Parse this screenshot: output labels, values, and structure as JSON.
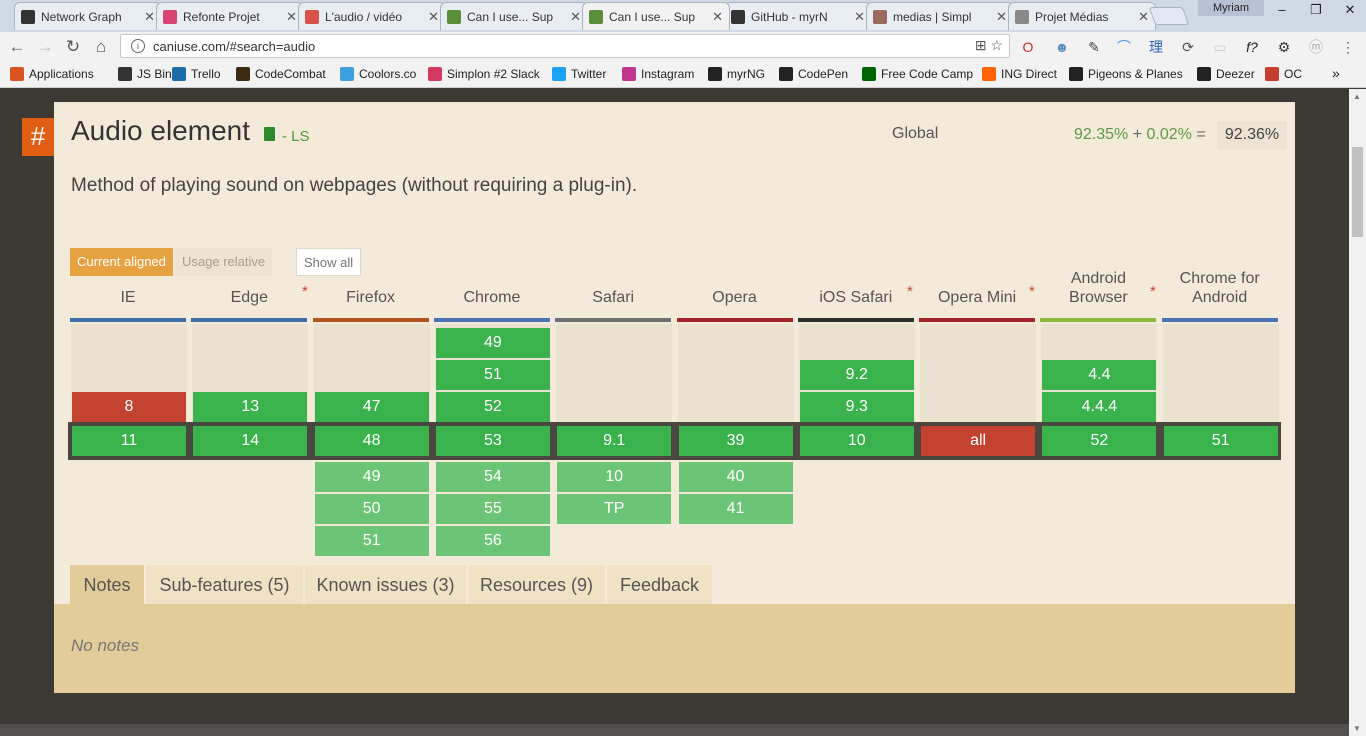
{
  "browser": {
    "tabs": [
      {
        "title": "Network Graph",
        "icon": "github-icon",
        "color": "#333333"
      },
      {
        "title": "Refonte Projet",
        "icon": "trello-icon",
        "color": "#d84572"
      },
      {
        "title": "L'audio / vidéo",
        "icon": "asterisk-icon",
        "color": "#d8524a"
      },
      {
        "title": "Can I use... Sup",
        "icon": "caniuse-icon",
        "color": "#5b8f3a"
      },
      {
        "title": "Can I use... Sup",
        "icon": "caniuse-icon",
        "color": "#5b8f3a"
      },
      {
        "title": "GitHub - myrN",
        "icon": "github-icon",
        "color": "#333333"
      },
      {
        "title": "medias | Simpl",
        "icon": "hash-icon",
        "color": "#9b6a5f"
      },
      {
        "title": "Projet Médias",
        "icon": "document-icon",
        "color": "#888888"
      }
    ],
    "profile_name": "Myriam",
    "url": "caniuse.com/#search=audio",
    "bookmarks": [
      {
        "label": "Applications",
        "icon": "apps-icon",
        "color": "#d9541e"
      },
      {
        "label": "JS Bin",
        "icon": "jsbin-icon",
        "color": "#333333"
      },
      {
        "label": "Trello",
        "icon": "trello-icon",
        "color": "#1c6ca8"
      },
      {
        "label": "CodeCombat",
        "icon": "codecombat-icon",
        "color": "#3b2b12"
      },
      {
        "label": "Coolors.co",
        "icon": "coolors-icon",
        "color": "#3da0dc"
      },
      {
        "label": "Simplon #2 Slack",
        "icon": "slack-icon",
        "color": "#d23b5f"
      },
      {
        "label": "Twitter",
        "icon": "twitter-icon",
        "color": "#1da1f2"
      },
      {
        "label": "Instagram",
        "icon": "instagram-icon",
        "color": "#c1358b"
      },
      {
        "label": "myrNG",
        "icon": "github-icon",
        "color": "#222222"
      },
      {
        "label": "CodePen",
        "icon": "codepen-icon",
        "color": "#222222"
      },
      {
        "label": "Free Code Camp",
        "icon": "freecodecamp-icon",
        "color": "#006400"
      },
      {
        "label": "ING Direct",
        "icon": "ing-icon",
        "color": "#ff6200"
      },
      {
        "label": "Pigeons & Planes",
        "icon": "pigeons-icon",
        "color": "#222222"
      },
      {
        "label": "Deezer",
        "icon": "deezer-icon",
        "color": "#222222"
      },
      {
        "label": "OC",
        "icon": "oc-icon",
        "color": "#c53e2e"
      }
    ],
    "more_bookmarks": "»"
  },
  "feature": {
    "hash": "#",
    "title": "Audio element",
    "status": "- LS",
    "description": "Method of playing sound on webpages (without requiring a plug-in).",
    "scope": "Global",
    "supported": "92.35%",
    "plus": "+",
    "partial": "0.02%",
    "equals": "=",
    "total": "92.36%"
  },
  "buttons": {
    "current_aligned": "Current aligned",
    "usage_relative": "Usage relative",
    "show_all": "Show all"
  },
  "browsers": [
    {
      "name": "IE",
      "accent": "#3d6ea5",
      "note": false,
      "past": [
        {
          "v": "8",
          "s": "n"
        }
      ],
      "current": {
        "v": "11",
        "s": "y"
      },
      "future": []
    },
    {
      "name": "Edge",
      "accent": "#3d6ea5",
      "note": true,
      "past": [
        {
          "v": "13",
          "s": "y"
        }
      ],
      "current": {
        "v": "14",
        "s": "y"
      },
      "future": []
    },
    {
      "name": "Firefox",
      "accent": "#b0551e",
      "note": false,
      "past": [
        {
          "v": "47",
          "s": "y"
        }
      ],
      "current": {
        "v": "48",
        "s": "y"
      },
      "future": [
        {
          "v": "49",
          "s": "f"
        },
        {
          "v": "50",
          "s": "f"
        },
        {
          "v": "51",
          "s": "f"
        }
      ]
    },
    {
      "name": "Chrome",
      "accent": "#4a74b5",
      "note": false,
      "past": [
        {
          "v": "49",
          "s": "y"
        },
        {
          "v": "51",
          "s": "y"
        },
        {
          "v": "52",
          "s": "y"
        }
      ],
      "current": {
        "v": "53",
        "s": "y"
      },
      "future": [
        {
          "v": "54",
          "s": "f"
        },
        {
          "v": "55",
          "s": "f"
        },
        {
          "v": "56",
          "s": "f"
        }
      ]
    },
    {
      "name": "Safari",
      "accent": "#707070",
      "note": false,
      "past": [],
      "current": {
        "v": "9.1",
        "s": "y"
      },
      "future": [
        {
          "v": "10",
          "s": "f"
        },
        {
          "v": "TP",
          "s": "f"
        }
      ]
    },
    {
      "name": "Opera",
      "accent": "#a4232a",
      "note": false,
      "past": [],
      "current": {
        "v": "39",
        "s": "y"
      },
      "future": [
        {
          "v": "40",
          "s": "f"
        },
        {
          "v": "41",
          "s": "f"
        }
      ]
    },
    {
      "name": "iOS Safari",
      "accent": "#2e2e2e",
      "note": true,
      "past": [
        {
          "v": "9.2",
          "s": "y"
        },
        {
          "v": "9.3",
          "s": "y"
        }
      ],
      "current": {
        "v": "10",
        "s": "y"
      },
      "future": []
    },
    {
      "name": "Opera Mini",
      "accent": "#a4232a",
      "note": true,
      "past": [],
      "current": {
        "v": "all",
        "s": "n"
      },
      "future": []
    },
    {
      "name": "Android Browser",
      "accent": "#8cb73d",
      "note": true,
      "past": [
        {
          "v": "4.4",
          "s": "y"
        },
        {
          "v": "4.4.4",
          "s": "y"
        }
      ],
      "current": {
        "v": "52",
        "s": "y"
      },
      "future": []
    },
    {
      "name": "Chrome for Android",
      "accent": "#4a74b5",
      "note": false,
      "past": [],
      "current": {
        "v": "51",
        "s": "y"
      },
      "future": []
    }
  ],
  "note_tabs": [
    "Notes",
    "Sub-features (5)",
    "Known issues (3)",
    "Resources (9)",
    "Feedback"
  ],
  "notes_text": "No notes"
}
